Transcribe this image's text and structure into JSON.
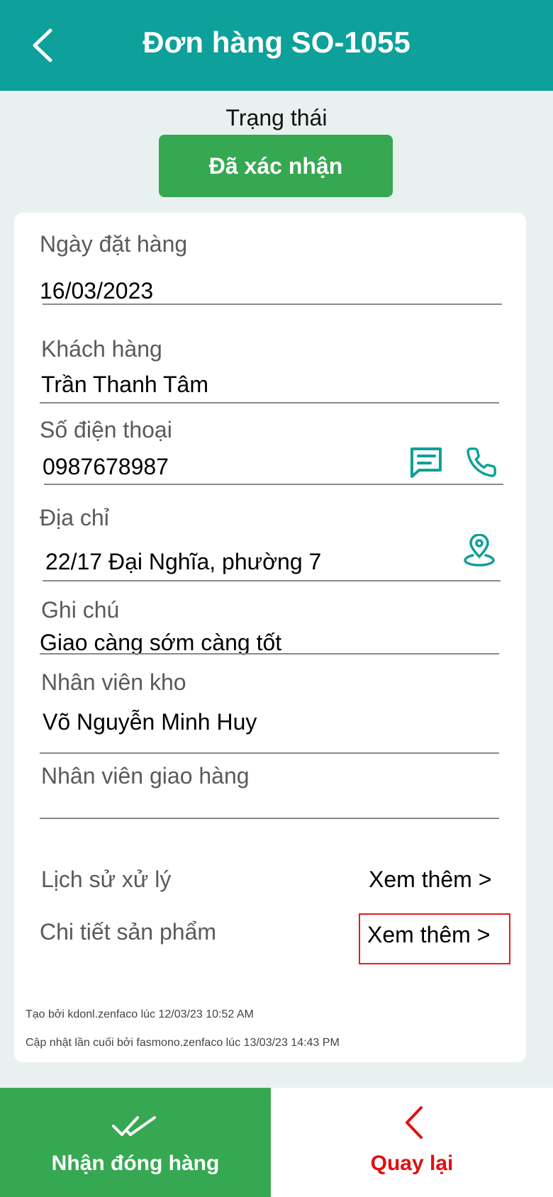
{
  "header": {
    "title": "Đơn hàng SO-1055",
    "back_icon": "chevron-left-icon"
  },
  "status": {
    "label": "Trạng thái",
    "value": "Đã xác nhận",
    "color": "#36a852"
  },
  "form": {
    "order_date": {
      "label": "Ngày đặt hàng",
      "value": "16/03/2023"
    },
    "customer": {
      "label": "Khách hàng",
      "value": "Trần Thanh Tâm"
    },
    "phone": {
      "label": "Số điện thoại",
      "value": "0987678987",
      "icons": [
        "message-icon",
        "phone-icon"
      ]
    },
    "address": {
      "label": "Địa chỉ",
      "value": "22/17 Đại Nghĩa, phường 7",
      "icon": "map-pin-icon"
    },
    "note": {
      "label": "Ghi chú",
      "value": "Giao càng sớm càng tốt"
    },
    "warehouse_staff": {
      "label": "Nhân viên kho",
      "value": "Võ Nguyễn Minh Huy"
    },
    "delivery_staff": {
      "label": "Nhân viên giao hàng",
      "value": ""
    }
  },
  "links": {
    "history": {
      "label": "Lịch sử xử lý",
      "action": "Xem thêm >"
    },
    "products": {
      "label": "Chi tiết sản phẩm",
      "action": "Xem thêm >"
    }
  },
  "meta": {
    "created": "Tạo bởi kdonl.zenfaco lúc 12/03/23 10:52 AM",
    "updated": "Cập nhật lần cuối bởi fasmono.zenfaco lúc 13/03/23 14:43 PM"
  },
  "actions": {
    "confirm": {
      "label": "Nhận đóng hàng",
      "icon": "double-check-icon",
      "color": "#36a852"
    },
    "back": {
      "label": "Quay lại",
      "icon": "chevron-left-icon",
      "color": "#e01010"
    }
  },
  "colors": {
    "header": "#0ea09a",
    "accent": "#0ea09a",
    "highlight": "#e02020"
  }
}
